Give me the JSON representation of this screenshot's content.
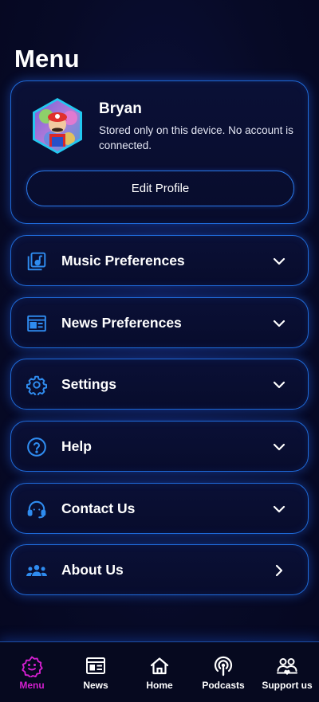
{
  "page": {
    "title": "Menu"
  },
  "profile": {
    "name": "Bryan",
    "description": "Stored only on this device. No account is connected.",
    "edit_button": "Edit Profile",
    "avatar_icon": "avatar-hexagon"
  },
  "menu": {
    "items": [
      {
        "label": "Music Preferences",
        "icon": "music-library-icon",
        "chevron": "chevron-down"
      },
      {
        "label": "News Preferences",
        "icon": "newspaper-icon",
        "chevron": "chevron-down"
      },
      {
        "label": "Settings",
        "icon": "gear-icon",
        "chevron": "chevron-down"
      },
      {
        "label": "Help",
        "icon": "help-circle-icon",
        "chevron": "chevron-down"
      },
      {
        "label": "Contact Us",
        "icon": "headset-icon",
        "chevron": "chevron-down"
      },
      {
        "label": "About Us",
        "icon": "group-icon",
        "chevron": "chevron-right"
      }
    ]
  },
  "tabbar": {
    "tabs": [
      {
        "label": "Menu",
        "icon": "menu-badge-icon",
        "active": true
      },
      {
        "label": "News",
        "icon": "news-icon",
        "active": false
      },
      {
        "label": "Home",
        "icon": "home-icon",
        "active": false
      },
      {
        "label": "Podcasts",
        "icon": "podcast-icon",
        "active": false
      },
      {
        "label": "Support us",
        "icon": "support-icon",
        "active": false
      }
    ]
  },
  "colors": {
    "background": "#070a26",
    "card_border": "#1f6ad8",
    "icon_accent": "#2f8cf0",
    "active_tab": "#d41fd0",
    "text": "#ffffff"
  }
}
